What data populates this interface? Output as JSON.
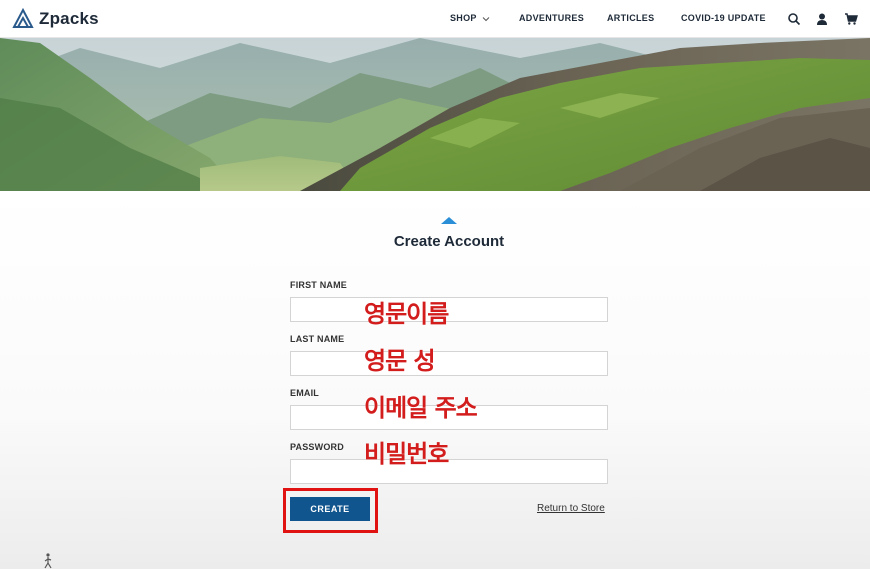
{
  "brand": {
    "name": "Zpacks"
  },
  "nav": {
    "shop": "SHOP",
    "adventures": "ADVENTURES",
    "articles": "ARTICLES",
    "covid": "COVID-19 UPDATE"
  },
  "icons": [
    "search-icon",
    "account-icon",
    "cart-icon",
    "chevron-down-icon",
    "zpacks-logo-icon"
  ],
  "page": {
    "title": "Create Account"
  },
  "form": {
    "first_name_label": "FIRST NAME",
    "last_name_label": "LAST NAME",
    "email_label": "EMAIL",
    "password_label": "PASSWORD",
    "first_name_value": "",
    "last_name_value": "",
    "email_value": "",
    "password_value": "",
    "create_label": "CREATE",
    "return_label": "Return to Store"
  },
  "annotations": {
    "first_name": "영문이름",
    "last_name": "영문 성",
    "email": "이메일 주소",
    "password": "비밀번호"
  },
  "colors": {
    "accent": "#2b8fd8",
    "button": "#11558e",
    "annotation": "#d31d1d",
    "highlight_box": "#e11212"
  }
}
